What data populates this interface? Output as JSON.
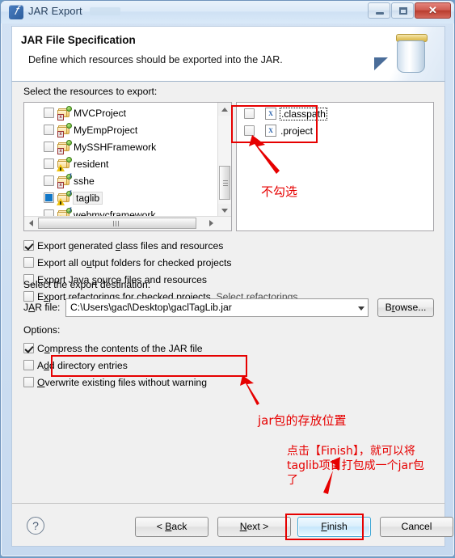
{
  "window": {
    "title": "JAR Export",
    "icon": "jar-export-icon",
    "controls": {
      "minimize": "–",
      "maximize": "□",
      "close": "✕"
    }
  },
  "banner": {
    "title": "JAR File Specification",
    "subtitle": "Define which resources should be exported into the JAR.",
    "icon": "jar-banner-icon"
  },
  "resources": {
    "label": "Select the resources to export:",
    "left_tree": [
      {
        "name": "MVCProject",
        "checked": "off",
        "selected": false,
        "icon": "java-web-project-icon"
      },
      {
        "name": "MyEmpProject",
        "checked": "off",
        "selected": false,
        "icon": "java-web-project-icon"
      },
      {
        "name": "MySSHFramework",
        "checked": "off",
        "selected": false,
        "icon": "java-web-project-icon"
      },
      {
        "name": "resident",
        "checked": "off",
        "selected": false,
        "icon": "java-project-warning-icon"
      },
      {
        "name": "sshe",
        "checked": "off",
        "selected": false,
        "icon": "java-web-project-icon"
      },
      {
        "name": "taglib",
        "checked": "half",
        "selected": true,
        "icon": "java-project-warning-icon"
      },
      {
        "name": "webmvcframework",
        "checked": "off",
        "selected": false,
        "icon": "java-project-warning-icon"
      }
    ],
    "right_tree": [
      {
        "name": ".classpath",
        "checked": "off",
        "selected": true,
        "icon": "xml-file-icon"
      },
      {
        "name": ".project",
        "checked": "off",
        "selected": false,
        "icon": "xml-file-icon"
      }
    ]
  },
  "options_top": [
    {
      "label_pre": "Export generated ",
      "label_mn": "c",
      "label_post": "lass files and resources",
      "checked": true
    },
    {
      "label_pre": "Export all o",
      "label_mn": "u",
      "label_post": "tput folders for checked projects",
      "checked": false
    },
    {
      "label_pre": "Export Java ",
      "label_mn": "s",
      "label_post": "ource files and resources",
      "checked": false
    },
    {
      "label_pre": "E",
      "label_mn": "x",
      "label_post": "port refactorings for checked projects.",
      "checked": false,
      "link": "Select refactorings..."
    }
  ],
  "destination": {
    "section_label": "Select the export destination:",
    "field_label_pre": "J",
    "field_label_mn": "A",
    "field_label_post": "R file:",
    "jar_file_value": "C:\\Users\\gacl\\Desktop\\gaclTagLib.jar",
    "browse_label_pre": "B",
    "browse_label_mn": "r",
    "browse_label_post": "owse..."
  },
  "options": {
    "label": "Options:",
    "items": [
      {
        "label_pre": "C",
        "label_mn": "o",
        "label_post": "mpress the contents of the JAR file",
        "checked": true
      },
      {
        "label_pre": "A",
        "label_mn": "d",
        "label_post": "d directory entries",
        "checked": false
      },
      {
        "label_pre": "",
        "label_mn": "O",
        "label_post": "verwrite existing files without warning",
        "checked": false
      }
    ]
  },
  "footer": {
    "help_icon": "?",
    "buttons": [
      {
        "pre": "< ",
        "mn": "B",
        "post": "ack",
        "name": "back-button",
        "default": false
      },
      {
        "pre": "",
        "mn": "N",
        "post": "ext >",
        "name": "next-button",
        "default": false
      },
      {
        "pre": "",
        "mn": "F",
        "post": "inish",
        "name": "finish-button",
        "default": true
      },
      {
        "pre": "",
        "mn": "",
        "post": "Cancel",
        "name": "cancel-button",
        "default": false
      }
    ]
  },
  "annotations": {
    "color": "#e60000",
    "note_no_check": "不勾选",
    "note_jar_location": "jar包的存放位置",
    "note_finish_line1": "点击【Finish】，就可以将",
    "note_finish_line2": "taglib项目打包成一个jar包",
    "note_finish_line3": "了"
  }
}
